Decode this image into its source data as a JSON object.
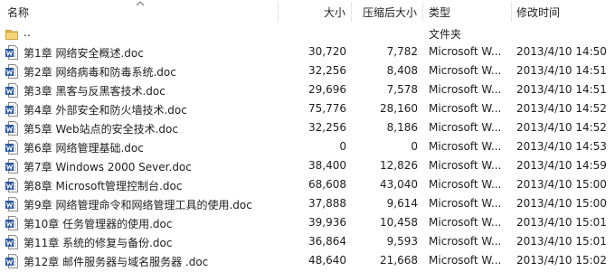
{
  "columns": {
    "name": "名称",
    "size": "大小",
    "compressed": "压缩后大小",
    "type": "类型",
    "modified": "修改时间"
  },
  "rows": [
    {
      "icon": "folder-icon",
      "name": "..",
      "size": "",
      "compressed": "",
      "type": "文件夹",
      "modified": ""
    },
    {
      "icon": "word-doc-icon",
      "name": "第1章 网络安全概述.doc",
      "size": "30,720",
      "compressed": "7,782",
      "type": "Microsoft W...",
      "modified": "2013/4/10 14:50"
    },
    {
      "icon": "word-doc-icon",
      "name": "第2章 网络病毒和防毒系统.doc",
      "size": "32,256",
      "compressed": "8,408",
      "type": "Microsoft W...",
      "modified": "2013/4/10 14:51"
    },
    {
      "icon": "word-doc-icon",
      "name": "第3章 黑客与反黑客技术.doc",
      "size": "29,696",
      "compressed": "7,578",
      "type": "Microsoft W...",
      "modified": "2013/4/10 14:51"
    },
    {
      "icon": "word-doc-icon",
      "name": "第4章 外部安全和防火墙技术.doc",
      "size": "75,776",
      "compressed": "28,160",
      "type": "Microsoft W...",
      "modified": "2013/4/10 14:52"
    },
    {
      "icon": "word-doc-icon",
      "name": "第5章 Web站点的安全技术.doc",
      "size": "32,256",
      "compressed": "8,186",
      "type": "Microsoft W...",
      "modified": "2013/4/10 14:52"
    },
    {
      "icon": "word-doc-icon",
      "name": "第6章 网络管理基础.doc",
      "size": "0",
      "compressed": "0",
      "type": "Microsoft W...",
      "modified": "2013/4/10 14:53"
    },
    {
      "icon": "word-doc-icon",
      "name": "第7章 Windows 2000 Sever.doc",
      "size": "38,400",
      "compressed": "12,826",
      "type": "Microsoft W...",
      "modified": "2013/4/10 14:59"
    },
    {
      "icon": "word-doc-icon",
      "name": "第8章 Microsoft管理控制台.doc",
      "size": "68,608",
      "compressed": "43,040",
      "type": "Microsoft W...",
      "modified": "2013/4/10 15:00"
    },
    {
      "icon": "word-doc-icon",
      "name": "第9章 网络管理命令和网络管理工具的使用.doc",
      "size": "37,888",
      "compressed": "9,614",
      "type": "Microsoft W...",
      "modified": "2013/4/10 15:00"
    },
    {
      "icon": "word-doc-icon",
      "name": "第10章 任务管理器的使用.doc",
      "size": "39,936",
      "compressed": "10,458",
      "type": "Microsoft W...",
      "modified": "2013/4/10 15:01"
    },
    {
      "icon": "word-doc-icon",
      "name": "第11章 系统的修复与备份.doc",
      "size": "36,864",
      "compressed": "9,593",
      "type": "Microsoft W...",
      "modified": "2013/4/10 15:01"
    },
    {
      "icon": "word-doc-icon",
      "name": "第12章 邮件服务器与域名服务器   .doc",
      "size": "48,640",
      "compressed": "21,668",
      "type": "Microsoft W...",
      "modified": "2013/4/10 15:02"
    }
  ],
  "colors": {
    "folder": "#e8c15a",
    "word_blue": "#2b579a",
    "hover": "#e5f3ff"
  }
}
